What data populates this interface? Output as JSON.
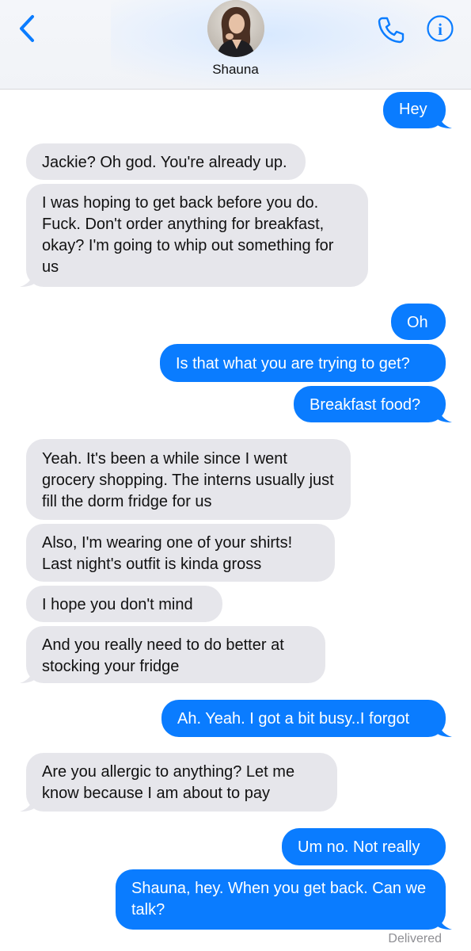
{
  "header": {
    "contact_name": "Shauna",
    "back_icon": "chevron-left-icon",
    "call_icon": "phone-icon",
    "info_icon": "info-icon",
    "accent_color": "#0a7cff"
  },
  "messages": [
    {
      "from": "me",
      "text": "Hey"
    },
    {
      "from": "them",
      "text": "Jackie? Oh god. You're already up."
    },
    {
      "from": "them",
      "text": "I was hoping to get back before you do. Fuck. Don't order anything for breakfast, okay? I'm going to whip out something for us"
    },
    {
      "from": "me",
      "text": "Oh"
    },
    {
      "from": "me",
      "text": "Is that what you are trying to get?"
    },
    {
      "from": "me",
      "text": "Breakfast food?"
    },
    {
      "from": "them",
      "text": "Yeah. It's been a while since I went grocery shopping. The interns usually just fill the dorm fridge for us"
    },
    {
      "from": "them",
      "text": "Also, I'm wearing one of your shirts! Last night's outfit is kinda gross"
    },
    {
      "from": "them",
      "text": "I hope you don't mind"
    },
    {
      "from": "them",
      "text": "And you really need to do better at stocking your fridge"
    },
    {
      "from": "me",
      "text": "Ah. Yeah. I got a bit busy..I forgot"
    },
    {
      "from": "them",
      "text": "Are you allergic to anything? Let me know because I am about to pay"
    },
    {
      "from": "me",
      "text": "Um no. Not really"
    },
    {
      "from": "me",
      "text": "Shauna, hey. When you get back. Can we talk?"
    }
  ],
  "status": {
    "delivered": "Delivered"
  },
  "colors": {
    "sent_bubble": "#0a7cff",
    "received_bubble": "#e6e6eb"
  }
}
